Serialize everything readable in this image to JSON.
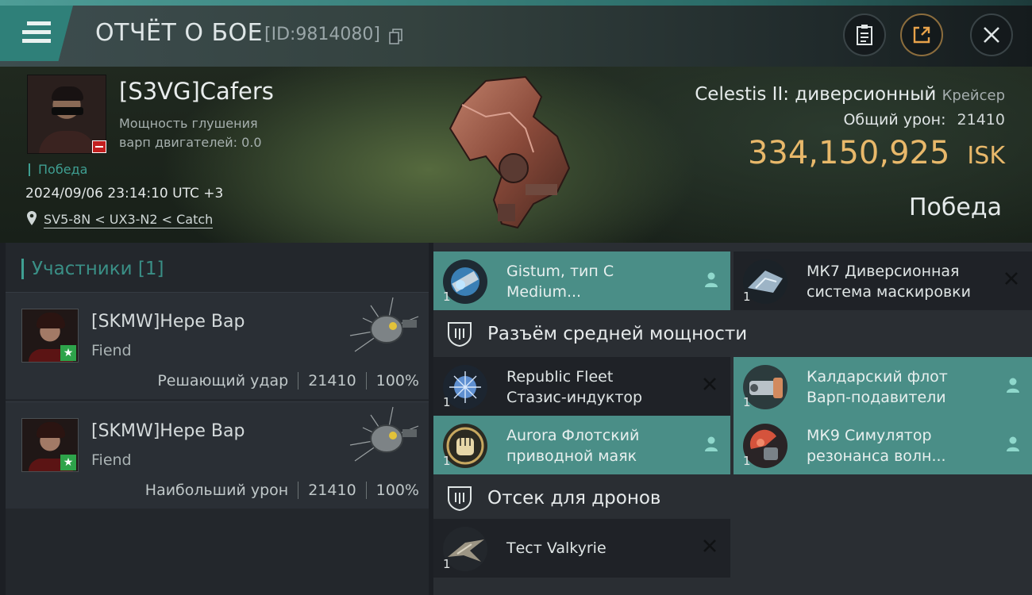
{
  "header": {
    "title": "ОТЧЁТ О БОЕ",
    "report_id": "[ID:9814080]",
    "icons": [
      "menu-icon",
      "copy-icon",
      "clipboard-icon",
      "share-icon",
      "close-icon"
    ]
  },
  "hero": {
    "pilot_name": "[S3VG]Cafers",
    "stat_label_1": "Мощность глушения",
    "stat_label_2": "варп  двигателей: 0.0",
    "result_tag": "Победа",
    "datetime": "2024/09/06 23:14:10 UTC +3",
    "location": "SV5-8N < UX3-N2 < Catch",
    "ship_name": "Celestis II: диверсионный",
    "ship_class": "Крейсер",
    "damage_label": "Общий урон:",
    "damage_value": "21410",
    "isk_value": "334,150,925",
    "isk_unit": "ISK",
    "result": "Победа"
  },
  "participants": {
    "title": "Участники [1]",
    "items": [
      {
        "name": "[SKMW]Нере Вар",
        "ship": "Fiend",
        "role": "Решающий удар",
        "damage": "21410",
        "percent": "100%"
      },
      {
        "name": "[SKMW]Нере Вар",
        "ship": "Fiend",
        "role": "Наибольший урон",
        "damage": "21410",
        "percent": "100%"
      }
    ]
  },
  "fittings": {
    "top_modules": [
      {
        "line1": "Gistum, тип C",
        "line2": "Medium...",
        "qty": "1",
        "active": true,
        "status": "user"
      },
      {
        "line1": "МК7 Диверсионная",
        "line2": "система маскировки",
        "qty": "1",
        "active": false,
        "status": "x"
      }
    ],
    "mid_section": "Разъём средней мощности",
    "mid_modules": [
      {
        "line1": "Republic Fleet",
        "line2": "Стазис-индуктор",
        "qty": "1",
        "active": false,
        "status": "x"
      },
      {
        "line1": "Калдарский флот",
        "line2": "Варп-подавители",
        "qty": "1",
        "active": true,
        "status": "user"
      },
      {
        "line1": "Aurora Флотский",
        "line2": "приводной маяк",
        "qty": "1",
        "active": true,
        "status": "user"
      },
      {
        "line1": "МК9 Симулятор",
        "line2": "резонанса волн...",
        "qty": "1",
        "active": true,
        "status": "user"
      }
    ],
    "drone_section": "Отсек для дронов",
    "drone_modules": [
      {
        "line1": "Тест Valkyrie",
        "line2": "",
        "qty": "1",
        "active": false,
        "status": "x"
      }
    ]
  },
  "colors": {
    "accent_teal": "#4a8e87",
    "isk_gold": "#e8b86a",
    "victory_green": "#3f9f92",
    "badge_red": "#c21f1f",
    "badge_green": "#2ea34a"
  }
}
